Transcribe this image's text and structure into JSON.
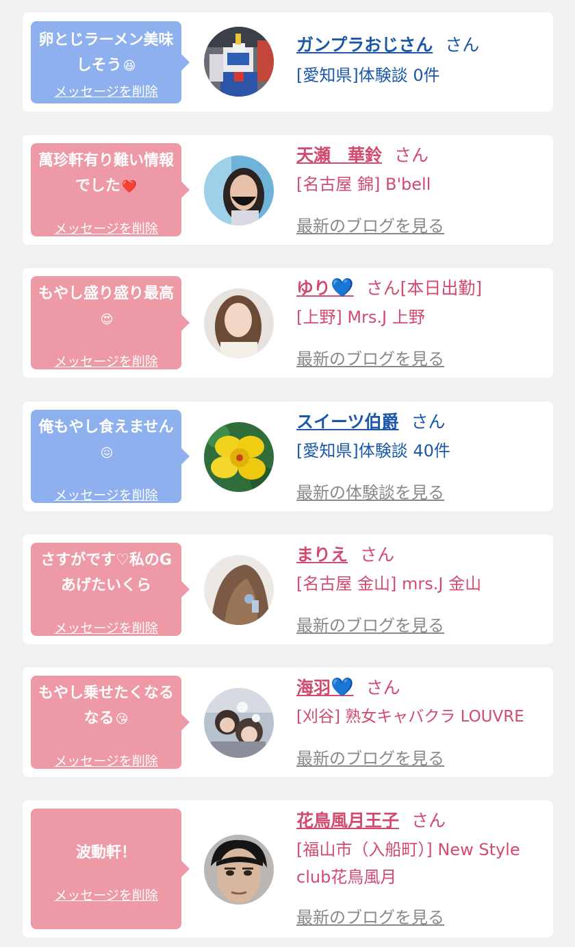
{
  "messages": [
    {
      "theme": "blue",
      "text": "卵とじラーメン美味しそう",
      "emoji": "😆",
      "delete_label": "メッセージを削除",
      "name": "ガンプラおじさん",
      "heart": "",
      "san": "さん",
      "shop": "[愛知県]体験談 0件",
      "latest_link": "",
      "avatar": "robot-photo"
    },
    {
      "theme": "pink",
      "text": "萬珍軒有り難い情報でした",
      "emoji": "❤️",
      "delete_label": "メッセージを削除",
      "name": "天瀬　華鈴",
      "heart": "",
      "san": "さん",
      "shop": "[名古屋 錦] B'bell",
      "latest_link": "最新のブログを見る",
      "avatar": "woman-mask-photo"
    },
    {
      "theme": "pink",
      "text": "もやし盛り盛り最高",
      "emoji": "😍",
      "delete_label": "メッセージを削除",
      "name": "ゆり",
      "heart": "💙",
      "san": "さん[本日出勤]",
      "shop": "[上野] Mrs.J 上野",
      "latest_link": "最新のブログを見る",
      "avatar": "woman-photo"
    },
    {
      "theme": "blue",
      "text": "俺もやし食えません",
      "emoji": "😖",
      "delete_label": "メッセージを削除",
      "name": "スイーツ伯爵",
      "heart": "",
      "san": "さん",
      "shop": "[愛知県]体験談 40件",
      "latest_link": "最新の体験談を見る",
      "avatar": "flower-photo"
    },
    {
      "theme": "pink",
      "text": "さすがです♡私のGあげたいくら",
      "emoji": "",
      "delete_label": "メッセージを削除",
      "name": "まりえ",
      "heart": "",
      "san": "さん",
      "shop": "[名古屋 金山] mrs.J 金山",
      "latest_link": "最新のブログを見る",
      "avatar": "hair-photo"
    },
    {
      "theme": "pink",
      "text": "もやし乗せたくなるなる",
      "emoji": "😘",
      "delete_label": "メッセージを削除",
      "name": "海羽",
      "heart": "💙",
      "san": "さん",
      "shop": "[刈谷] 熟女キャバクラ LOUVRE",
      "latest_link": "最新のブログを見る",
      "avatar": "selfie-photo"
    },
    {
      "theme": "pink",
      "text": "波動軒！",
      "emoji": "",
      "delete_label": "メッセージを削除",
      "name": "花鳥風月王子",
      "heart": "",
      "san": "さん",
      "shop": "[福山市（入船町）] New Style club花鳥風月",
      "latest_link": "最新のブログを見る",
      "avatar": "man-face-photo"
    }
  ]
}
